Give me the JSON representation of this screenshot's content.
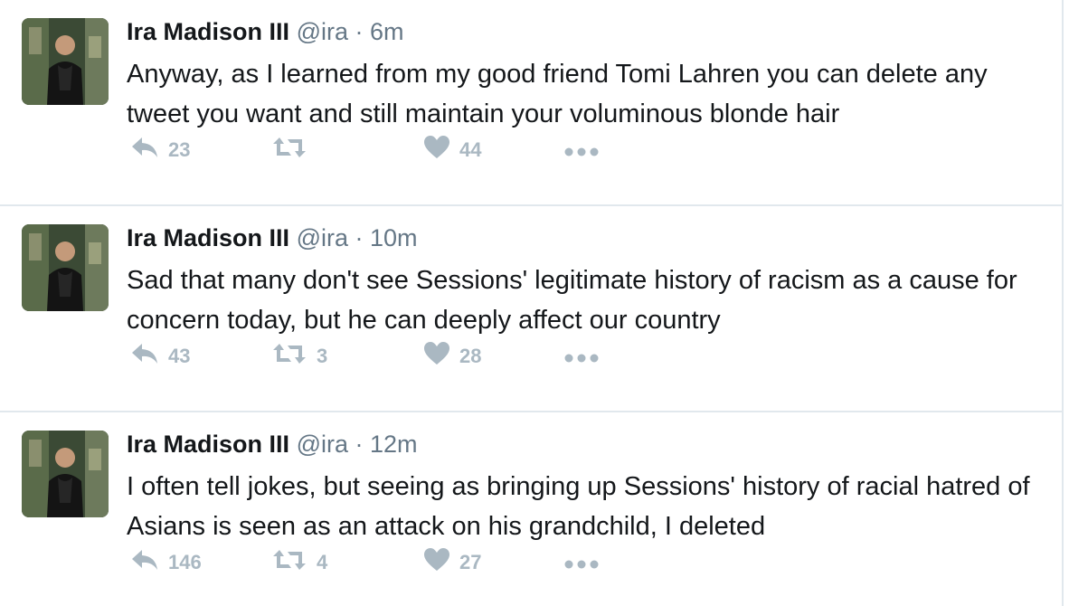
{
  "colors": {
    "name": "#14171a",
    "meta": "#657786",
    "icon": "#aab8c2",
    "divider": "#e1e8ed"
  },
  "tweets": [
    {
      "name": "Ira Madison III",
      "handle": "@ira",
      "dot": "·",
      "time": "6m",
      "text": "Anyway, as I learned from my good friend Tomi Lahren you can delete any tweet you want and still maintain your voluminous blonde hair",
      "replies": "23",
      "retweets": "",
      "likes": "44"
    },
    {
      "name": "Ira Madison III",
      "handle": "@ira",
      "dot": "·",
      "time": "10m",
      "text": "Sad that many don't see Sessions' legitimate history of racism as a cause for concern today, but he can deeply affect our country",
      "replies": "43",
      "retweets": "3",
      "likes": "28"
    },
    {
      "name": "Ira Madison III",
      "handle": "@ira",
      "dot": "·",
      "time": "12m",
      "text": "I often tell jokes, but seeing as bringing up Sessions' history of racial hatred of Asians is seen as an attack on his grandchild, I deleted",
      "replies": "146",
      "retweets": "4",
      "likes": "27"
    }
  ]
}
